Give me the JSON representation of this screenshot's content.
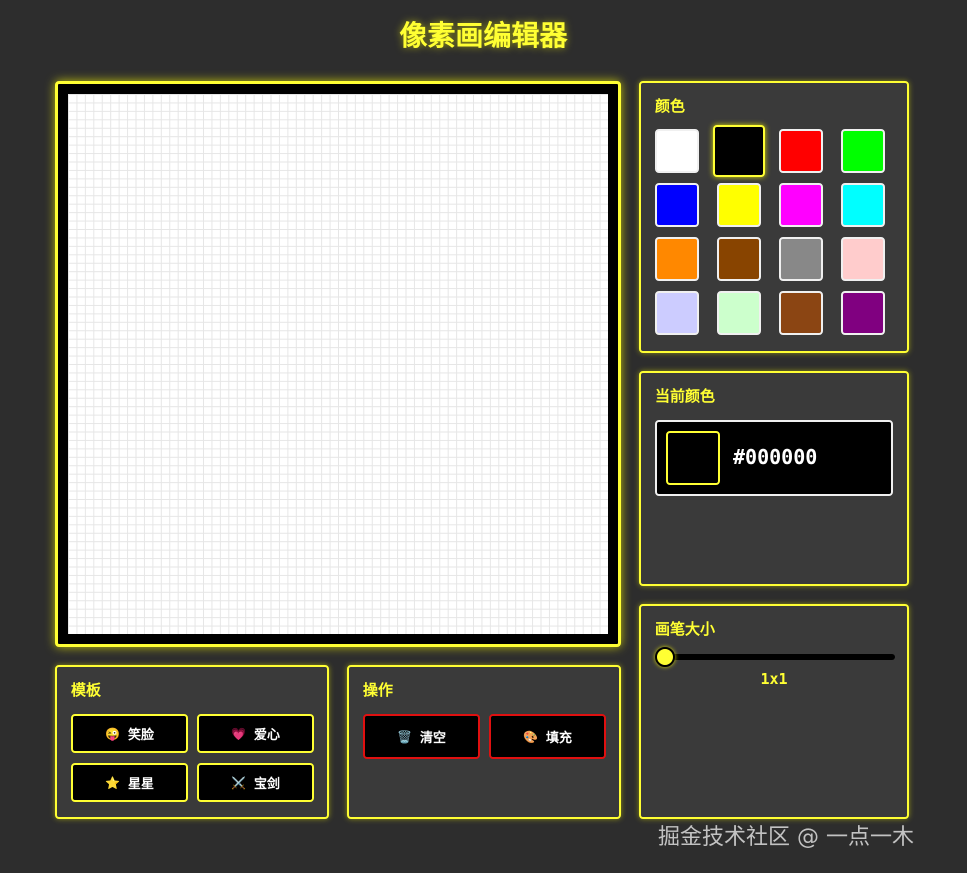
{
  "app": {
    "title": "像素画编辑器"
  },
  "palette": {
    "title": "颜色",
    "selected": "#000000",
    "colors": [
      "#ffffff",
      "#000000",
      "#ff0000",
      "#00ff00",
      "#0000ff",
      "#ffff00",
      "#ff00ff",
      "#00ffff",
      "#ff8800",
      "#884400",
      "#888888",
      "#ffcccc",
      "#ccccff",
      "#ccffcc",
      "#8b4513",
      "#800080"
    ]
  },
  "current_color": {
    "title": "当前颜色",
    "hex": "#000000"
  },
  "brush": {
    "title": "画笔大小",
    "value_label": "1x1",
    "level": 0.0
  },
  "templates": {
    "title": "模板",
    "items": [
      {
        "icon": "😜",
        "label": "笑脸"
      },
      {
        "icon": "💗",
        "label": "爱心"
      },
      {
        "icon": "⭐",
        "label": "星星"
      },
      {
        "icon": "⚔️",
        "label": "宝剑"
      }
    ]
  },
  "actions": {
    "title": "操作",
    "items": [
      {
        "icon": "🗑️",
        "label": "清空"
      },
      {
        "icon": "🎨",
        "label": "填充"
      }
    ]
  },
  "watermark": "掘金技术社区 @ 一点一木",
  "theme": {
    "accent": "#ffff33",
    "background": "#2d2d2d",
    "panel": "#3a3a3a",
    "danger": "#e01010"
  }
}
